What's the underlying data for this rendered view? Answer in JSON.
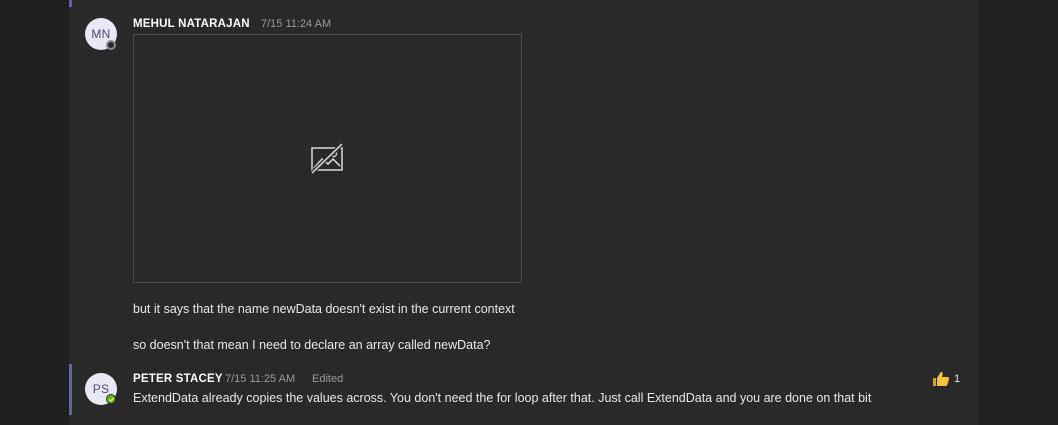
{
  "messages": [
    {
      "sender": "MEHUL NATARAJAN",
      "initials": "MN",
      "timestamp": "7/15 11:24 AM",
      "presence": "offline",
      "attachment": "broken-image",
      "lines": [
        "but it says that the name newData doesn't exist in the current context",
        "so doesn't that mean I need to declare an array called newData?"
      ]
    },
    {
      "sender": "PETER STACEY",
      "initials": "PS",
      "timestamp": "7/15 11:25 AM",
      "edited_label": "Edited",
      "presence": "online",
      "text": "ExtendData already copies the values across. You don't need the for loop after that. Just call ExtendData and you are done on that bit",
      "reaction": {
        "icon": "thumbs-up-icon",
        "count": "1"
      }
    }
  ],
  "colors": {
    "accent": "#6264a7",
    "online": "#6bb700",
    "reaction": "#f5c23b"
  }
}
